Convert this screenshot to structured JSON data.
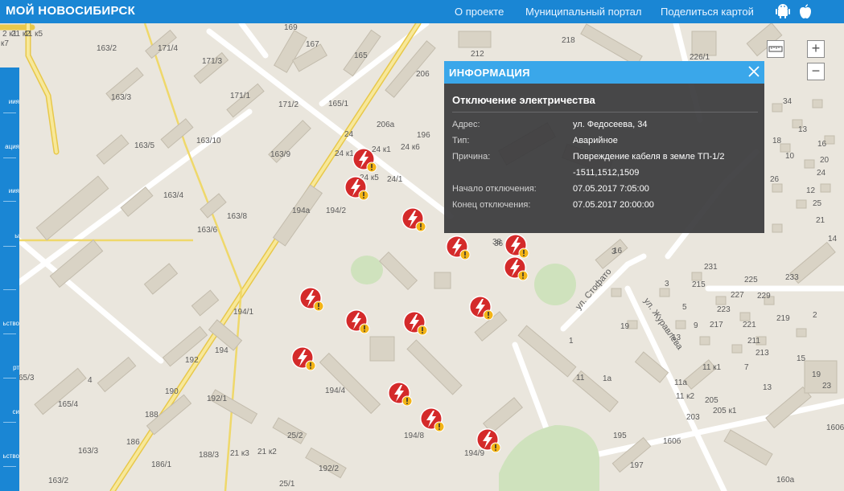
{
  "header": {
    "brand": "МОЙ НОВОСИБИРСК",
    "nav": [
      "О проекте",
      "Муниципальный портал",
      "Поделиться картой"
    ],
    "app_icons": [
      "android-icon",
      "apple-icon"
    ]
  },
  "sidebar": {
    "items": [
      "иия",
      "ация",
      "иия",
      "ы",
      "",
      "ьство",
      "рт",
      "си",
      "ьство"
    ]
  },
  "map": {
    "labels": [
      "169",
      "167",
      "165",
      "163/2",
      "171/4",
      "171/3",
      "171/1",
      "163/3",
      "171/2",
      "165/1",
      "163/5",
      "163/10",
      "163/9",
      "24",
      "24/1",
      "206а",
      "196",
      "206",
      "24 к1",
      "24 к5",
      "24 к6",
      "24/1",
      "163/4",
      "163/8",
      "194а",
      "194/2",
      "163/6",
      "194/1",
      "194",
      "192",
      "192/1",
      "190",
      "188",
      "186",
      "186/1",
      "188/3",
      "21 к3",
      "21 к2",
      "163/3",
      "163/2",
      "25/2",
      "25/1",
      "192/2",
      "194/4",
      "194/8",
      "194/9",
      "4",
      "163/5",
      "65/3",
      "65/4",
      "195",
      "197",
      "1",
      "1а",
      "11а",
      "11 к2",
      "205",
      "205 к1",
      "203",
      "11 к1",
      "160а",
      "160б",
      "233",
      "231",
      "225",
      "215",
      "219",
      "229",
      "221",
      "227",
      "223",
      "217",
      "211",
      "213",
      "3",
      "5",
      "9",
      "13",
      "26",
      "25",
      "22",
      "21",
      "14",
      "18",
      "10",
      "12",
      "16",
      "20",
      "24",
      "13",
      "7",
      "11",
      "15",
      "19",
      "23",
      "2",
      "34",
      "38",
      "36",
      "13",
      "1606",
      "218",
      "212",
      "226/1",
      "24 к2",
      "21 к5",
      "11 к5",
      "к7",
      "19",
      "3"
    ],
    "streets": [
      "ул. Стофато",
      "ул. Журавлева"
    ]
  },
  "popup": {
    "title": "ИНФОРМАЦИЯ",
    "event": "Отключение электричества",
    "rows": [
      {
        "key": "Адрес:",
        "value": "ул. Федосеева, 34"
      },
      {
        "key": "Тип:",
        "value": "Аварийное"
      },
      {
        "key": "Причина:",
        "value": "Повреждение кабеля в земле ТП-1/2 -1511,1512,1509"
      },
      {
        "key": "Начало отключения:",
        "value": "07.05.2017 7:05:00"
      },
      {
        "key": "Конец отключения:",
        "value": "07.05.2017 20:00:00"
      }
    ]
  },
  "controls": {
    "zoom_in": "+",
    "zoom_out": "−"
  },
  "colors": {
    "header": "#1a86d4",
    "popup_header": "#3aa7ea",
    "marker": "#d42a2a",
    "warning": "#f3b416",
    "road_major": "#f2dc78"
  }
}
